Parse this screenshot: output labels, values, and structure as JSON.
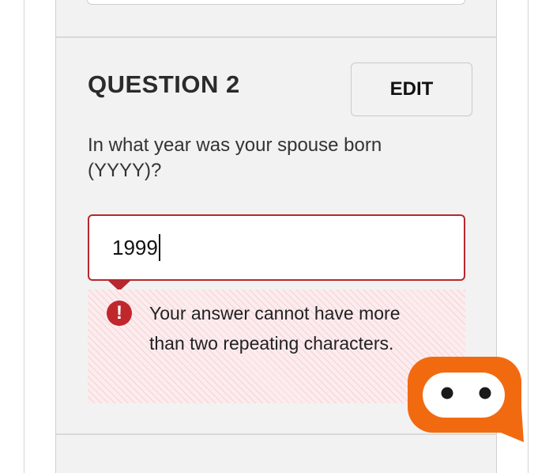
{
  "question": {
    "title": "QUESTION 2",
    "edit_label": "EDIT",
    "prompt": "In what year was your spouse born (YYYY)?"
  },
  "answer": {
    "value": "1999"
  },
  "error": {
    "message": "Your answer cannot have more than two repeating characters.",
    "icon": "exclamation-icon",
    "color": "#b8272e"
  },
  "chat_widget": {
    "icon": "chatbot-icon",
    "color": "#f26a10"
  }
}
